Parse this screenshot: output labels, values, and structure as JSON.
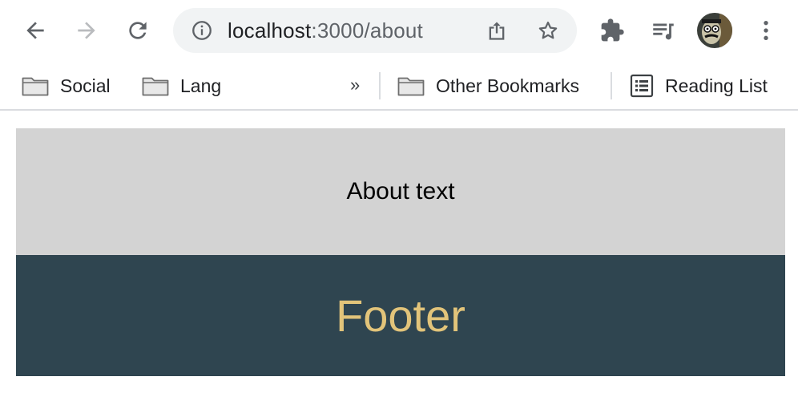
{
  "browser": {
    "url_host": "localhost",
    "url_path": ":3000/about",
    "icons": {
      "back": "arrow-left-icon",
      "forward": "arrow-right-icon",
      "reload": "reload-icon",
      "info": "info-icon",
      "share": "share-icon",
      "bookmark_star": "star-icon",
      "extensions": "puzzle-icon",
      "media": "media-playlist-icon",
      "profile": "avatar",
      "menu": "kebab-menu-icon"
    }
  },
  "bookmarks_bar": {
    "items": [
      {
        "label": "Social",
        "icon": "folder-icon"
      },
      {
        "label": "Lang",
        "icon": "folder-icon"
      }
    ],
    "overflow": "»",
    "other_bookmarks": "Other Bookmarks",
    "reading_list": "Reading List"
  },
  "page": {
    "about_text": "About text",
    "footer_text": "Footer"
  },
  "colors": {
    "about_bg": "#d3d3d3",
    "footer_bg": "#2f4550",
    "footer_text": "#e2c47a",
    "omnibox_bg": "#f1f3f4",
    "icon": "#5f6368"
  }
}
